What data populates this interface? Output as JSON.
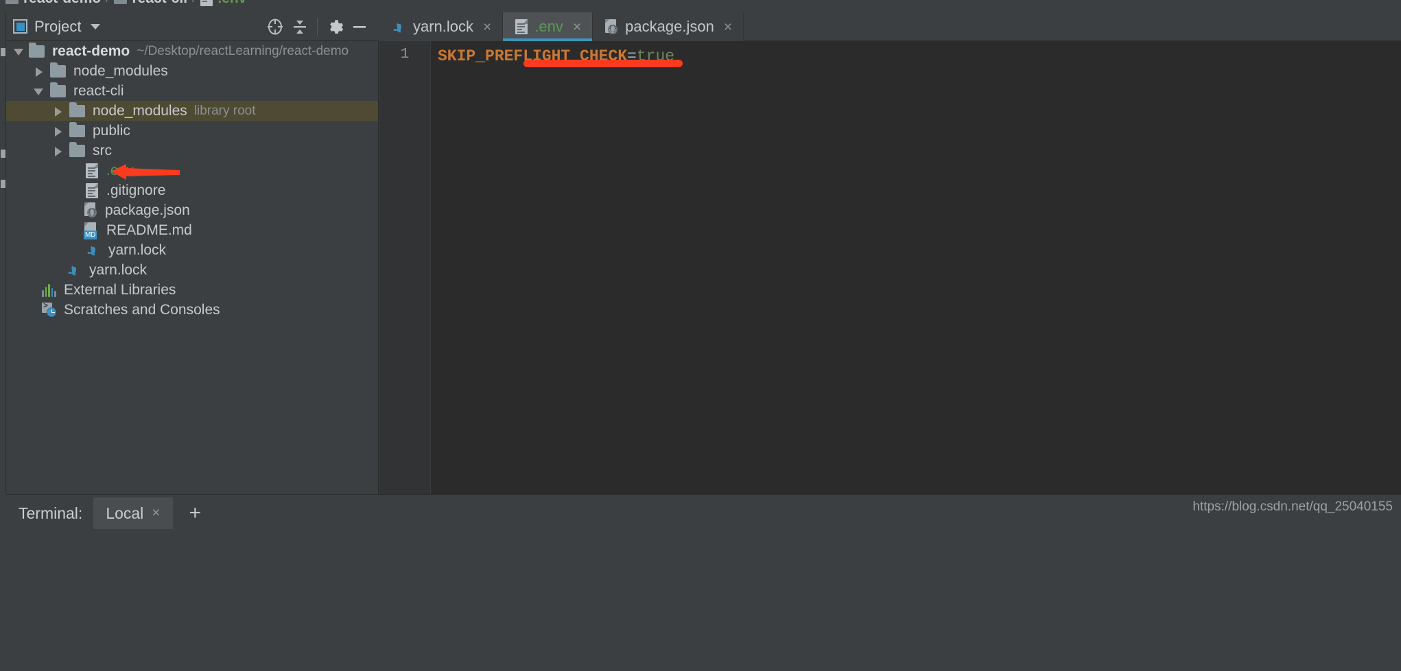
{
  "breadcrumb": {
    "items": [
      {
        "label": "react-demo",
        "icon": "folder-icon"
      },
      {
        "label": "react-cli",
        "icon": "folder-icon"
      },
      {
        "label": ".env",
        "icon": "file-icon"
      }
    ],
    "separator": "/"
  },
  "project_panel": {
    "title": "Project",
    "dropdown_icon": "chevron-down-icon",
    "toolbar": [
      {
        "name": "select-opened-file-icon",
        "label": "Select Opened File"
      },
      {
        "name": "collapse-all-icon",
        "label": "Collapse All"
      },
      {
        "name": "gear-icon",
        "label": "Settings"
      },
      {
        "name": "minimize-icon",
        "label": "Hide"
      }
    ],
    "tree": [
      {
        "label": "react-demo",
        "secondary": "~/Desktop/reactLearning/react-demo",
        "icon": "folder-icon",
        "arrow": "down",
        "indent": 0,
        "bold": true,
        "highlighted": false,
        "color": "default"
      },
      {
        "label": "node_modules",
        "secondary": "",
        "icon": "folder-icon",
        "arrow": "right",
        "indent": 1,
        "bold": false,
        "highlighted": false,
        "color": "default"
      },
      {
        "label": "react-cli",
        "secondary": "",
        "icon": "folder-icon",
        "arrow": "down",
        "indent": 1,
        "bold": false,
        "highlighted": false,
        "color": "default"
      },
      {
        "label": "node_modules",
        "secondary": "library root",
        "icon": "folder-icon",
        "arrow": "right",
        "indent": 2,
        "bold": false,
        "highlighted": true,
        "color": "default"
      },
      {
        "label": "public",
        "secondary": "",
        "icon": "folder-icon",
        "arrow": "right",
        "indent": 2,
        "bold": false,
        "highlighted": false,
        "color": "default"
      },
      {
        "label": "src",
        "secondary": "",
        "icon": "folder-icon",
        "arrow": "right",
        "indent": 2,
        "bold": false,
        "highlighted": false,
        "color": "default"
      },
      {
        "label": ".env",
        "secondary": "",
        "icon": "file-icon",
        "arrow": "none",
        "indent": 3,
        "bold": false,
        "highlighted": false,
        "color": "green"
      },
      {
        "label": ".gitignore",
        "secondary": "",
        "icon": "file-icon",
        "arrow": "none",
        "indent": 3,
        "bold": false,
        "highlighted": false,
        "color": "default"
      },
      {
        "label": "package.json",
        "secondary": "",
        "icon": "json-file-icon",
        "arrow": "none",
        "indent": 3,
        "bold": false,
        "highlighted": false,
        "color": "default"
      },
      {
        "label": "README.md",
        "secondary": "",
        "icon": "markdown-file-icon",
        "arrow": "none",
        "indent": 3,
        "bold": false,
        "highlighted": false,
        "color": "default"
      },
      {
        "label": "yarn.lock",
        "secondary": "",
        "icon": "yarn-cat-icon",
        "arrow": "none",
        "indent": 3,
        "bold": false,
        "highlighted": false,
        "color": "default"
      },
      {
        "label": "yarn.lock",
        "secondary": "",
        "icon": "yarn-cat-icon",
        "arrow": "none",
        "indent": 2,
        "bold": false,
        "highlighted": false,
        "color": "default"
      },
      {
        "label": "External Libraries",
        "secondary": "",
        "icon": "libraries-bars-icon",
        "arrow": "none",
        "indent": 1,
        "bold": false,
        "highlighted": false,
        "color": "default"
      },
      {
        "label": "Scratches and Consoles",
        "secondary": "",
        "icon": "scratches-icon",
        "arrow": "none",
        "indent": 1,
        "bold": false,
        "highlighted": false,
        "color": "default"
      }
    ]
  },
  "editor_tabs": [
    {
      "label": "yarn.lock",
      "icon": "yarn-cat-icon",
      "active": false,
      "close_glyph": "×",
      "color": "default"
    },
    {
      "label": ".env",
      "icon": "file-icon",
      "active": true,
      "close_glyph": "×",
      "color": "green"
    },
    {
      "label": "package.json",
      "icon": "json-file-icon",
      "active": false,
      "close_glyph": "×",
      "color": "default"
    }
  ],
  "editor": {
    "line_numbers": [
      "1"
    ],
    "code": {
      "key": "SKIP_PREFLIGHT_CHECK",
      "equals": "=",
      "value": "true"
    },
    "annotation": {
      "underline_color": "#fb3b1e",
      "arrow_color": "#fb3b1e"
    }
  },
  "status_bar": {
    "terminal_label": "Terminal:",
    "terminal_tab": "Local",
    "terminal_close_glyph": "×",
    "add_glyph": "+",
    "watermark": "https://blog.csdn.net/qq_25040155"
  },
  "colors": {
    "bg_panel": "#3c3f41",
    "bg_editor": "#2b2b2b",
    "accent_tab_underline": "#3d94b8",
    "highlight_row": "#4f4b32",
    "token_key": "#cc7832",
    "token_value": "#6a8759",
    "green_file": "#57965c",
    "annotation_red": "#fb3b1e"
  }
}
